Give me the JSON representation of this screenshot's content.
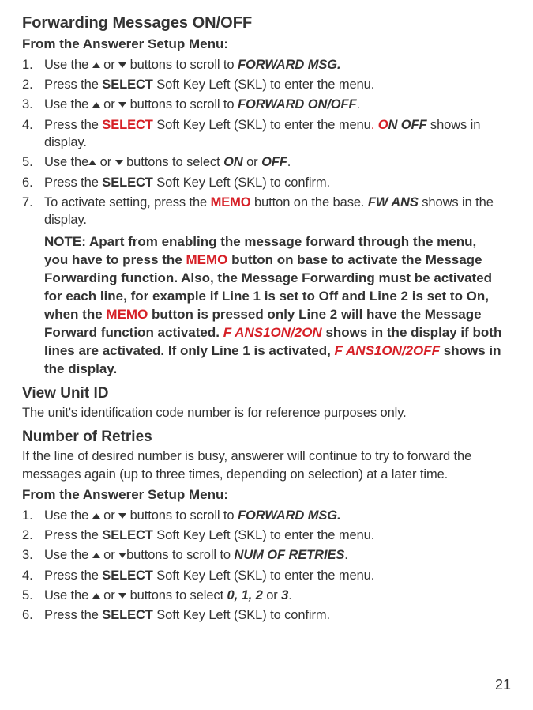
{
  "section1": {
    "title": "Forwarding Messages ON/OFF",
    "subtitle": "From the Answerer Setup Menu:",
    "steps": [
      {
        "num": "1.",
        "pre": "Use the ",
        "mid": " or ",
        "post": "  buttons to scroll to ",
        "target": "FORWARD MSG."
      },
      {
        "num": "2.",
        "pre": "Press the ",
        "key": "SELECT",
        "post": " Soft Key Left (SKL) to enter the menu."
      },
      {
        "num": "3.",
        "pre": "Use the ",
        "mid": " or ",
        "post": " buttons to scroll to ",
        "target": "FORWARD ON/OFF",
        "tail": "."
      },
      {
        "num": "4.",
        "pre": "Press the ",
        "key": "SELECT",
        "post": " Soft Key Left (SKL) to enter the menu",
        "dot": ". ",
        "disp1": "O",
        "disp2": "N OFF",
        "tail": " shows in display."
      },
      {
        "num": "5.",
        "pre": "Use the",
        "mid": " or ",
        "post": " buttons to select ",
        "t1": "ON",
        "or": " or ",
        "t2": "OFF",
        "tail": "."
      },
      {
        "num": "6.",
        "pre": "Press the ",
        "key": "SELECT",
        "post": " Soft Key Left (SKL) to confirm."
      },
      {
        "num": "7.",
        "pre": "To activate setting, press the ",
        "key": "MEMO",
        "post": " button on the base. ",
        "disp": "FW ANS",
        "tail": " shows in the display."
      }
    ],
    "note": {
      "p1": "NOTE: Apart from enabling the message forward through the menu, you have to press the ",
      "r1": "MEMO",
      "p2": " button on base to activate the Message Forwarding function.  Also, the Message Forwarding must be activated for each line, for example if Line 1 is set to Off and Line 2 is set to On, when the ",
      "r2": "MEMO",
      "p3": " button is pressed only Line 2 will have the Message Forward function activated. ",
      "r3": "F ANS1ON/2ON",
      "p4": " shows in the display if both lines are activated. If only Line 1 is activated, ",
      "r4": "F ANS1ON/2OFF",
      "p5": " shows in the display."
    }
  },
  "section2": {
    "title": "View Unit ID",
    "body": "The unit's identification code number is for reference purposes only."
  },
  "section3": {
    "title": "Number of Retries",
    "body": "If the line of desired number is busy, answerer will continue to try to forward the messages again (up to three times, depending on selection) at a later time.",
    "subtitle": "From the Answerer Setup Menu:",
    "steps": [
      {
        "num": "1.",
        "pre": "Use the ",
        "mid": " or ",
        "post": "  buttons to scroll to ",
        "target": "FORWARD MSG."
      },
      {
        "num": "2.",
        "pre": "Press the ",
        "key": "SELECT",
        "post": " Soft Key Left (SKL) to enter the menu."
      },
      {
        "num": "3.",
        "pre": "Use the ",
        "mid": " or ",
        "post": "buttons to scroll to ",
        "target": "NUM OF RETRIES",
        "tail": "."
      },
      {
        "num": "4.",
        "pre": "Press the ",
        "key": "SELECT",
        "post": " Soft Key Left (SKL) to enter the menu."
      },
      {
        "num": "5.",
        "pre": "Use the ",
        "mid": " or ",
        "post": " buttons to select ",
        "t1": "0, 1, 2",
        "or": " or ",
        "t2": "3",
        "tail": "."
      },
      {
        "num": "6.",
        "pre": "Press the ",
        "key": "SELECT",
        "post": " Soft Key Left (SKL) to confirm."
      }
    ]
  },
  "pageNumber": "21"
}
